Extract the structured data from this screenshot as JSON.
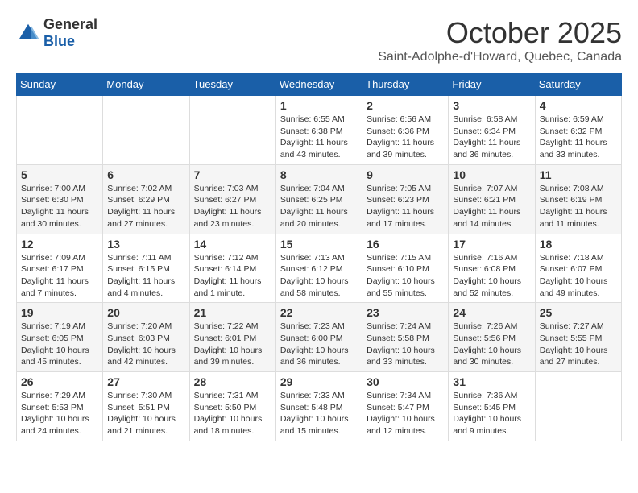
{
  "logo": {
    "text_general": "General",
    "text_blue": "Blue"
  },
  "title": {
    "month": "October 2025",
    "subtitle": "Saint-Adolphe-d'Howard, Quebec, Canada"
  },
  "weekdays": [
    "Sunday",
    "Monday",
    "Tuesday",
    "Wednesday",
    "Thursday",
    "Friday",
    "Saturday"
  ],
  "weeks": [
    [
      {
        "day": "",
        "info": ""
      },
      {
        "day": "",
        "info": ""
      },
      {
        "day": "",
        "info": ""
      },
      {
        "day": "1",
        "info": "Sunrise: 6:55 AM\nSunset: 6:38 PM\nDaylight: 11 hours and 43 minutes."
      },
      {
        "day": "2",
        "info": "Sunrise: 6:56 AM\nSunset: 6:36 PM\nDaylight: 11 hours and 39 minutes."
      },
      {
        "day": "3",
        "info": "Sunrise: 6:58 AM\nSunset: 6:34 PM\nDaylight: 11 hours and 36 minutes."
      },
      {
        "day": "4",
        "info": "Sunrise: 6:59 AM\nSunset: 6:32 PM\nDaylight: 11 hours and 33 minutes."
      }
    ],
    [
      {
        "day": "5",
        "info": "Sunrise: 7:00 AM\nSunset: 6:30 PM\nDaylight: 11 hours and 30 minutes."
      },
      {
        "day": "6",
        "info": "Sunrise: 7:02 AM\nSunset: 6:29 PM\nDaylight: 11 hours and 27 minutes."
      },
      {
        "day": "7",
        "info": "Sunrise: 7:03 AM\nSunset: 6:27 PM\nDaylight: 11 hours and 23 minutes."
      },
      {
        "day": "8",
        "info": "Sunrise: 7:04 AM\nSunset: 6:25 PM\nDaylight: 11 hours and 20 minutes."
      },
      {
        "day": "9",
        "info": "Sunrise: 7:05 AM\nSunset: 6:23 PM\nDaylight: 11 hours and 17 minutes."
      },
      {
        "day": "10",
        "info": "Sunrise: 7:07 AM\nSunset: 6:21 PM\nDaylight: 11 hours and 14 minutes."
      },
      {
        "day": "11",
        "info": "Sunrise: 7:08 AM\nSunset: 6:19 PM\nDaylight: 11 hours and 11 minutes."
      }
    ],
    [
      {
        "day": "12",
        "info": "Sunrise: 7:09 AM\nSunset: 6:17 PM\nDaylight: 11 hours and 7 minutes."
      },
      {
        "day": "13",
        "info": "Sunrise: 7:11 AM\nSunset: 6:15 PM\nDaylight: 11 hours and 4 minutes."
      },
      {
        "day": "14",
        "info": "Sunrise: 7:12 AM\nSunset: 6:14 PM\nDaylight: 11 hours and 1 minute."
      },
      {
        "day": "15",
        "info": "Sunrise: 7:13 AM\nSunset: 6:12 PM\nDaylight: 10 hours and 58 minutes."
      },
      {
        "day": "16",
        "info": "Sunrise: 7:15 AM\nSunset: 6:10 PM\nDaylight: 10 hours and 55 minutes."
      },
      {
        "day": "17",
        "info": "Sunrise: 7:16 AM\nSunset: 6:08 PM\nDaylight: 10 hours and 52 minutes."
      },
      {
        "day": "18",
        "info": "Sunrise: 7:18 AM\nSunset: 6:07 PM\nDaylight: 10 hours and 49 minutes."
      }
    ],
    [
      {
        "day": "19",
        "info": "Sunrise: 7:19 AM\nSunset: 6:05 PM\nDaylight: 10 hours and 45 minutes."
      },
      {
        "day": "20",
        "info": "Sunrise: 7:20 AM\nSunset: 6:03 PM\nDaylight: 10 hours and 42 minutes."
      },
      {
        "day": "21",
        "info": "Sunrise: 7:22 AM\nSunset: 6:01 PM\nDaylight: 10 hours and 39 minutes."
      },
      {
        "day": "22",
        "info": "Sunrise: 7:23 AM\nSunset: 6:00 PM\nDaylight: 10 hours and 36 minutes."
      },
      {
        "day": "23",
        "info": "Sunrise: 7:24 AM\nSunset: 5:58 PM\nDaylight: 10 hours and 33 minutes."
      },
      {
        "day": "24",
        "info": "Sunrise: 7:26 AM\nSunset: 5:56 PM\nDaylight: 10 hours and 30 minutes."
      },
      {
        "day": "25",
        "info": "Sunrise: 7:27 AM\nSunset: 5:55 PM\nDaylight: 10 hours and 27 minutes."
      }
    ],
    [
      {
        "day": "26",
        "info": "Sunrise: 7:29 AM\nSunset: 5:53 PM\nDaylight: 10 hours and 24 minutes."
      },
      {
        "day": "27",
        "info": "Sunrise: 7:30 AM\nSunset: 5:51 PM\nDaylight: 10 hours and 21 minutes."
      },
      {
        "day": "28",
        "info": "Sunrise: 7:31 AM\nSunset: 5:50 PM\nDaylight: 10 hours and 18 minutes."
      },
      {
        "day": "29",
        "info": "Sunrise: 7:33 AM\nSunset: 5:48 PM\nDaylight: 10 hours and 15 minutes."
      },
      {
        "day": "30",
        "info": "Sunrise: 7:34 AM\nSunset: 5:47 PM\nDaylight: 10 hours and 12 minutes."
      },
      {
        "day": "31",
        "info": "Sunrise: 7:36 AM\nSunset: 5:45 PM\nDaylight: 10 hours and 9 minutes."
      },
      {
        "day": "",
        "info": ""
      }
    ]
  ]
}
